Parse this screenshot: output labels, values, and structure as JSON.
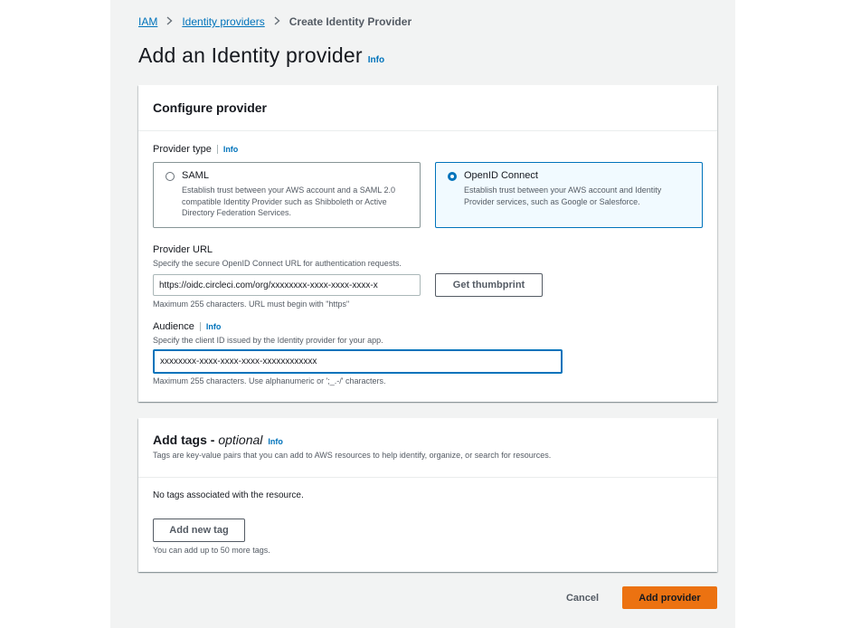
{
  "breadcrumb": {
    "items": [
      "IAM",
      "Identity providers"
    ],
    "current": "Create Identity Provider",
    "separator": ">"
  },
  "page": {
    "title": "Add an Identity provider",
    "info": "Info"
  },
  "configure": {
    "title": "Configure provider",
    "provider_type": {
      "label": "Provider type",
      "info": "Info",
      "options": [
        {
          "title": "SAML",
          "description": "Establish trust between your AWS account and a SAML 2.0 compatible Identity Provider such as Shibboleth or Active Directory Federation Services.",
          "selected": false
        },
        {
          "title": "OpenID Connect",
          "description": "Establish trust between your AWS account and Identity Provider services, such as Google or Salesforce.",
          "selected": true
        }
      ]
    },
    "provider_url": {
      "label": "Provider URL",
      "description": "Specify the secure OpenID Connect URL for authentication requests.",
      "value": "https://oidc.circleci.com/org/xxxxxxxx-xxxx-xxxx-xxxx-x",
      "constraint": "Maximum 255 characters. URL must begin with \"https\"",
      "thumbprint_button": "Get thumbprint"
    },
    "audience": {
      "label": "Audience",
      "info": "Info",
      "description": "Specify the client ID issued by the Identity provider for your app.",
      "value": "xxxxxxxx-xxxx-xxxx-xxxx-xxxxxxxxxxxx",
      "constraint": "Maximum 255 characters. Use alphanumeric or ';_.-/' characters."
    }
  },
  "tags": {
    "title": "Add tags - ",
    "optional": "optional",
    "info": "Info",
    "description": "Tags are key-value pairs that you can add to AWS resources to help identify, organize, or search for resources.",
    "empty_text": "No tags associated with the resource.",
    "add_button": "Add new tag",
    "limit_text": "You can add up to 50 more tags."
  },
  "footer": {
    "cancel": "Cancel",
    "submit": "Add provider"
  },
  "colors": {
    "link": "#0073bb",
    "primary": "#ec7211",
    "selected_bg": "#f1faff",
    "page_bg": "#f2f3f3"
  }
}
